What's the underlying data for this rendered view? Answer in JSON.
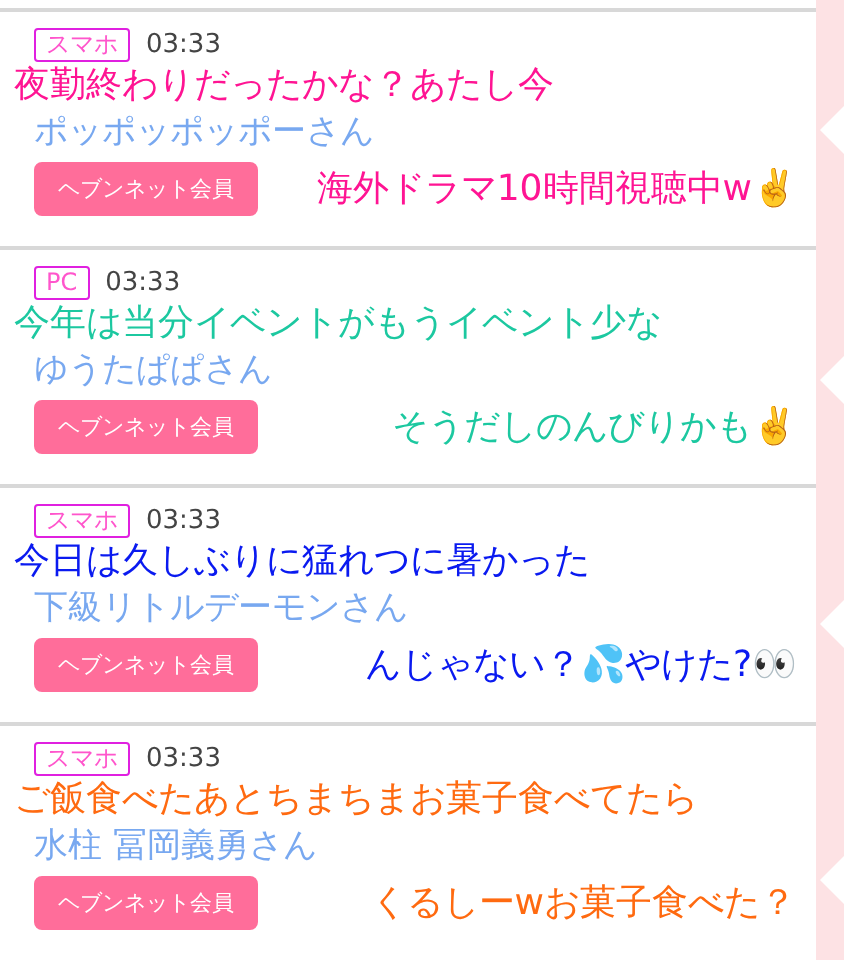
{
  "posts": [
    {
      "tag": "スマホ",
      "time": "03:33",
      "name": "ポッポッポッポーさん",
      "button": "ヘブンネット会員",
      "caption": {
        "color": "#ff1493",
        "lines": [
          "夜勤終わりだったかな？あたし今",
          "海外ドラマ10時間視聴中w✌️"
        ]
      }
    },
    {
      "tag": "PC",
      "time": "03:33",
      "name": "ゆうたぱぱさん",
      "button": "ヘブンネット会員",
      "caption": {
        "color": "#1cc8a0",
        "lines": [
          "今年は当分イベントがもうイベント少な",
          "そうだしのんびりかも✌️"
        ]
      }
    },
    {
      "tag": "スマホ",
      "time": "03:33",
      "name": "下級リトルデーモンさん",
      "button": "ヘブンネット会員",
      "caption": {
        "color": "#0a1af0",
        "lines": [
          "今日は久しぶりに猛れつに暑かった",
          "んじゃない？💦やけた?👀"
        ]
      }
    },
    {
      "tag": "スマホ",
      "time": "03:33",
      "name": "水柱 冨岡義勇さん",
      "button": "ヘブンネット会員",
      "caption": {
        "color": "#ff6a10",
        "lines": [
          "ご飯食べたあとちまちまお菓子食べてたら",
          "くるしーwお菓子食べた？"
        ]
      }
    }
  ]
}
